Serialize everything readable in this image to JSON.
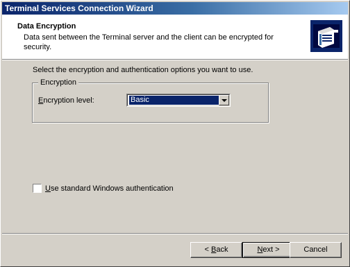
{
  "window": {
    "title": "Terminal Services Connection Wizard"
  },
  "header": {
    "title": "Data Encryption",
    "subtitle": "Data sent between the Terminal server and the client can be encrypted for security."
  },
  "content": {
    "instruction": "Select the encryption and authentication options you want to use.",
    "group_label": "Encryption",
    "encryption_label_mnemonic": "E",
    "encryption_label_rest": "ncryption level:",
    "encryption_level": "Basic",
    "auth_checkbox_mnemonic": "U",
    "auth_checkbox_rest": "se standard Windows authentication",
    "auth_checked": false
  },
  "buttons": {
    "back_prefix": "< ",
    "back_mnemonic": "B",
    "back_rest": "ack",
    "next_mnemonic": "N",
    "next_rest": "ext >",
    "cancel": "Cancel"
  },
  "icons": {
    "header_icon": "server-wizard-icon",
    "dropdown": "chevron-down-icon"
  }
}
